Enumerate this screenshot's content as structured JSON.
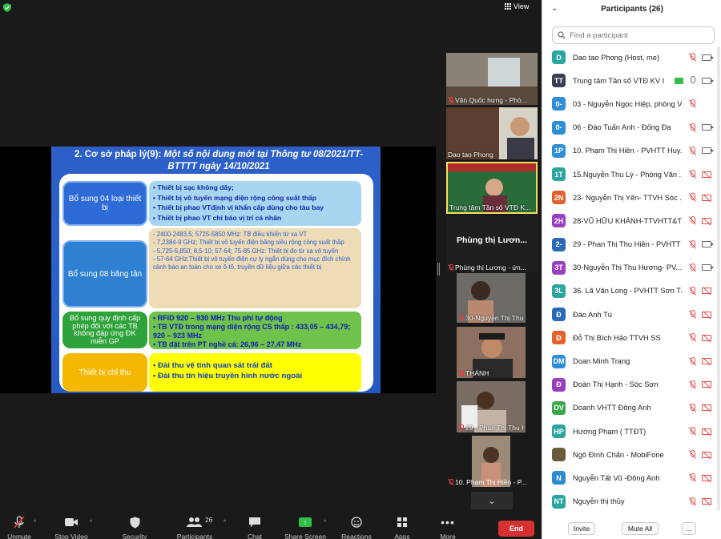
{
  "top": {
    "view_label": "View"
  },
  "slide": {
    "title_prefix": "2. Cơ sở pháp lý(9):",
    "title_rest": "Một số nội dung mới tại Thông tư 08/2021/TT-BTTTT ngày 14/10/2021",
    "rows": [
      {
        "left": "Bổ sung 04 loại thiết bị",
        "right": [
          "• Thiết bị sạc không dây;",
          "• Thiết bị vô tuyến mạng diện rộng công suất thấp",
          "• Thiết bị phao VTđịnh vị khẩn cấp dùng cho tàu bay",
          "• Thiết bị phao VT chỉ báo vị trí cá nhân"
        ]
      },
      {
        "left": "Bổ sung 08 băng tần",
        "right": [
          "- 2400-2483,5; 5725-5850 MHz: TB điều khiển từ xa VT",
          "- 7,2384-9 GHz; Thiết bị vô tuyến điện băng siêu rộng công suất thấp",
          "- 5,725-5,850; 8,5-10; 57-64; 75-85 GHz: Thiết bị đo từ xa vô tuyến",
          "- 57-64 GHz:Thiết bị vô tuyến điện cự ly ngắn dùng cho mục đích chính cảnh báo an toàn cho xe ô-tô, truyền dữ liệu giữa các thiết bị"
        ]
      },
      {
        "left": "Bổ sung quy định cấp phép đối với các TB không đáp ứng ĐK miễn GP",
        "right": [
          "• RFID 920 – 930 MHz Thu phí tự động",
          "• TB VTĐ trong mạng diện rộng CS thấp : 433,05 – 434,79; 920 – 923 MHz",
          "• TB đặt trên PT nghề cá: 26,96 – 27,47 MHz"
        ]
      },
      {
        "left": "Thiết bị chỉ thu",
        "right": [
          "• Đài thu vệ tinh quan sát trái đất",
          "• Đài thu tín hiệu truyền hình nước ngoài"
        ]
      }
    ]
  },
  "thumbnails": [
    {
      "name": "Văn Quốc hưng - Phò...",
      "muted": true
    },
    {
      "name": "Dao tao Phong",
      "muted": false
    },
    {
      "name": "Trung tâm Tần số VTĐ K...",
      "muted": false
    },
    {
      "name": "Phùng thị Lươn...",
      "muted": false,
      "title": "Phùng thị Lươn..."
    },
    {
      "name": "Phùng thị Lương - ứn...",
      "muted": true
    },
    {
      "name": "30-Nguyễn Thị Thu H...",
      "muted": true
    },
    {
      "name": "THÀNH",
      "muted": true
    },
    {
      "name": "29 - Phan Thị Thu Hiề...",
      "muted": true
    },
    {
      "name": "10. Phạm Thị Hiền - P...",
      "muted": true
    }
  ],
  "toolbar": {
    "unmute": "Unmute",
    "stop_video": "Stop Video",
    "security": "Security",
    "participants": "Participants",
    "participants_count": "26",
    "chat": "Chat",
    "share_screen": "Share Screen",
    "reactions": "Reactions",
    "apps": "Apps",
    "more": "More",
    "end": "End"
  },
  "panel": {
    "title": "Participants (26)",
    "search_placeholder": "Find a participant",
    "participants": [
      {
        "initials": "D",
        "color": "#2aa5a0",
        "name": "Dao tao Phong (Host, me)",
        "mic": "off",
        "cam": "on"
      },
      {
        "initials": "TT",
        "color": "#3a3f55",
        "name": "Trung tâm Tần số VTĐ KV I",
        "mic": "on",
        "cam": "on",
        "sharing": true
      },
      {
        "initials": "0-",
        "color": "#2f8fd6",
        "name": "03 - Nguyễn Ngọc Hiệp, phòng VH...",
        "mic": "off",
        "cam": "none"
      },
      {
        "initials": "0-",
        "color": "#2f8fd6",
        "name": "06 - Đào Tuấn Anh - Đống Đa",
        "mic": "off",
        "cam": "on"
      },
      {
        "initials": "1P",
        "color": "#2f8fd6",
        "name": "10. Phạm Thị Hiền - PVHTT Huy...",
        "mic": "off",
        "cam": "on"
      },
      {
        "initials": "1T",
        "color": "#2aa5a0",
        "name": "15.Nguyễn Thu Lý - Phòng Văn ...",
        "mic": "off",
        "cam": "off"
      },
      {
        "initials": "2N",
        "color": "#e2622c",
        "name": "23- Nguyễn Thị Yến- TTVH Sóc ...",
        "mic": "off",
        "cam": "off"
      },
      {
        "initials": "2H",
        "color": "#9a3fc0",
        "name": "28-VŨ HỮU KHÁNH-TTVHTT&T...",
        "mic": "off",
        "cam": "off"
      },
      {
        "initials": "2-",
        "color": "#2b6ab8",
        "name": "29 - Phan Thị Thu Hiền - PVHTT ...",
        "mic": "off",
        "cam": "on"
      },
      {
        "initials": "3T",
        "color": "#9a3fc0",
        "name": "30-Nguyễn Thị Thu Hương- PV...",
        "mic": "off",
        "cam": "on"
      },
      {
        "initials": "3L",
        "color": "#2aa5a0",
        "name": "36. Lã Văn Long - PVHTT Sơn Tây",
        "mic": "off",
        "cam": "off"
      },
      {
        "initials": "Đ",
        "color": "#2b6ab8",
        "name": "Đào Anh Tú",
        "mic": "off",
        "cam": "off"
      },
      {
        "initials": "Đ",
        "color": "#e2622c",
        "name": "Đỗ Thị Bích Hảo TTVH SS",
        "mic": "off",
        "cam": "off"
      },
      {
        "initials": "DM",
        "color": "#2f8fd6",
        "name": "Doan Minh Trang",
        "mic": "off",
        "cam": "off"
      },
      {
        "initials": "Đ",
        "color": "#9a3fc0",
        "name": "Đoàn Thị Hạnh - Sóc Sơn",
        "mic": "off",
        "cam": "off"
      },
      {
        "initials": "DV",
        "color": "#3aa64a",
        "name": "Doanh VHTT Đông Anh",
        "mic": "off",
        "cam": "off"
      },
      {
        "initials": "HP",
        "color": "#2aa5a0",
        "name": "Hương Phạm ( TTĐT)",
        "mic": "off",
        "cam": "off"
      },
      {
        "initials": "",
        "color": "#6b5a3a",
        "name": "Ngô Đình Chấn - MobiFone",
        "mic": "off",
        "cam": "off"
      },
      {
        "initials": "N",
        "color": "#2b8ad0",
        "name": "Nguyễn Tất Vũ -Đông Anh",
        "mic": "off",
        "cam": "off"
      },
      {
        "initials": "NT",
        "color": "#2aa5a0",
        "name": "Nguyễn thị thủy",
        "mic": "off",
        "cam": "off"
      }
    ],
    "invite": "Invite",
    "mute_all": "Mute All",
    "more": "..."
  }
}
